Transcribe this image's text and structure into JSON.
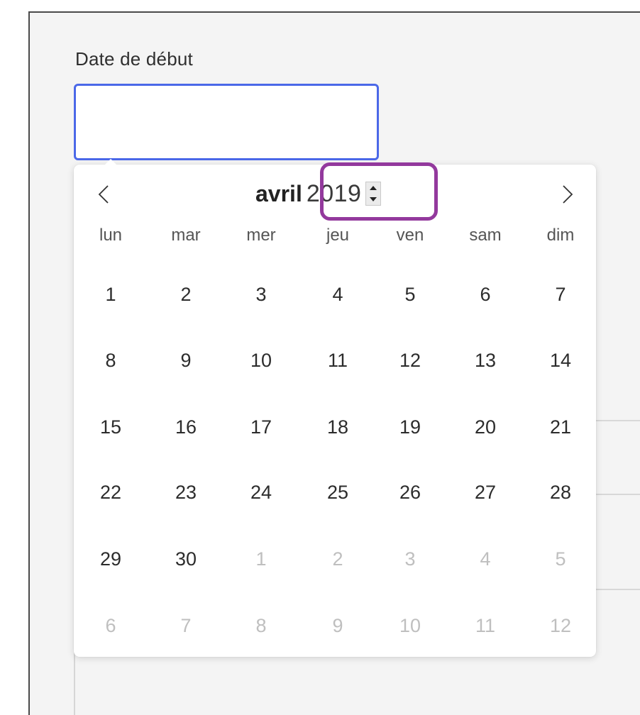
{
  "form": {
    "start_date_label": "Date de début",
    "start_date_value": ""
  },
  "datepicker": {
    "month": "avril",
    "year": "2019",
    "prev_icon": "chevron-left-icon",
    "next_icon": "chevron-right-icon",
    "weekdays": [
      "lun",
      "mar",
      "mer",
      "jeu",
      "ven",
      "sam",
      "dim"
    ],
    "weeks": [
      [
        {
          "d": "1",
          "m": false
        },
        {
          "d": "2",
          "m": false
        },
        {
          "d": "3",
          "m": false
        },
        {
          "d": "4",
          "m": false
        },
        {
          "d": "5",
          "m": false
        },
        {
          "d": "6",
          "m": false
        },
        {
          "d": "7",
          "m": false
        }
      ],
      [
        {
          "d": "8",
          "m": false
        },
        {
          "d": "9",
          "m": false
        },
        {
          "d": "10",
          "m": false
        },
        {
          "d": "11",
          "m": false
        },
        {
          "d": "12",
          "m": false
        },
        {
          "d": "13",
          "m": false
        },
        {
          "d": "14",
          "m": false
        }
      ],
      [
        {
          "d": "15",
          "m": false
        },
        {
          "d": "16",
          "m": false
        },
        {
          "d": "17",
          "m": false
        },
        {
          "d": "18",
          "m": false
        },
        {
          "d": "19",
          "m": false
        },
        {
          "d": "20",
          "m": false
        },
        {
          "d": "21",
          "m": false
        }
      ],
      [
        {
          "d": "22",
          "m": false
        },
        {
          "d": "23",
          "m": false
        },
        {
          "d": "24",
          "m": false
        },
        {
          "d": "25",
          "m": false
        },
        {
          "d": "26",
          "m": false
        },
        {
          "d": "27",
          "m": false
        },
        {
          "d": "28",
          "m": false
        }
      ],
      [
        {
          "d": "29",
          "m": false
        },
        {
          "d": "30",
          "m": false
        },
        {
          "d": "1",
          "m": true
        },
        {
          "d": "2",
          "m": true
        },
        {
          "d": "3",
          "m": true
        },
        {
          "d": "4",
          "m": true
        },
        {
          "d": "5",
          "m": true
        }
      ],
      [
        {
          "d": "6",
          "m": true
        },
        {
          "d": "7",
          "m": true
        },
        {
          "d": "8",
          "m": true
        },
        {
          "d": "9",
          "m": true
        },
        {
          "d": "10",
          "m": true
        },
        {
          "d": "11",
          "m": true
        },
        {
          "d": "12",
          "m": true
        }
      ]
    ]
  },
  "colors": {
    "input_focus_border": "#4b68e8",
    "highlight_annotation": "#93399d",
    "muted_day": "#bfbfbf"
  }
}
